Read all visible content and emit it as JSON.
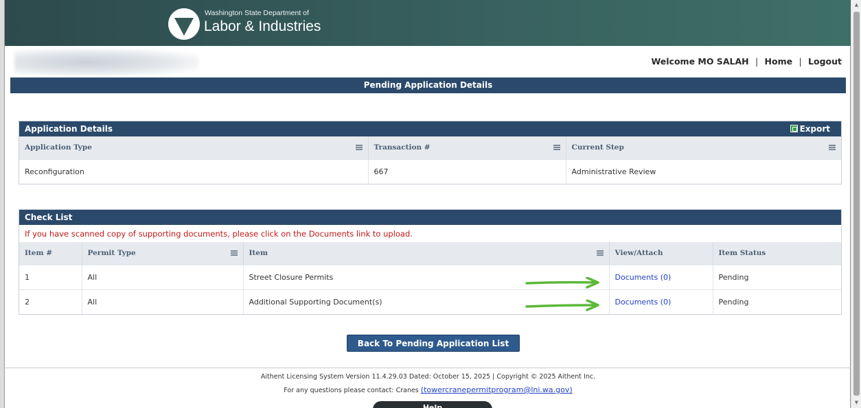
{
  "header": {
    "org_small": "Washington State Department of",
    "org_big": "Labor & Industries"
  },
  "nav": {
    "welcome": "Welcome MO SALAH",
    "home": "Home",
    "logout": "Logout",
    "separator": "|"
  },
  "page_title": "Pending Application Details",
  "application_details": {
    "title": "Application Details",
    "export_label": "Export",
    "columns": [
      "Application Type",
      "Transaction #",
      "Current Step"
    ],
    "row": [
      "Reconfiguration",
      "667",
      "Administrative Review"
    ]
  },
  "checklist": {
    "title": "Check List",
    "instruction": "If you have scanned copy of supporting documents, please click on the Documents link to upload.",
    "columns": [
      "Item #",
      "Permit Type",
      "Item",
      "View/Attach",
      "Item Status"
    ],
    "rows": [
      [
        "1",
        "All",
        "Street Closure Permits",
        "Documents (0)",
        "Pending"
      ],
      [
        "2",
        "All",
        "Additional Supporting Document(s)",
        "Documents (0)",
        "Pending"
      ]
    ]
  },
  "back_button": "Back To Pending Application List",
  "footer": {
    "line1": "Aithent Licensing System Version 11.4.29.03 Dated: October 15, 2025 | Copyright © 2025 Aithent Inc.",
    "line2_prefix": "For any questions please contact: Cranes",
    "email": "(towercranepermitprogram@lni.wa.gov)"
  },
  "help_tab": "Help",
  "colors": {
    "header_band": "#38605f",
    "section_bar": "#2b4a6b",
    "link": "#2441c8",
    "warning_text": "#c01818",
    "arrow": "#5cb83a"
  },
  "icons": [
    "lni-logo-icon",
    "export-icon",
    "column-menu-icon",
    "green-arrow-icon",
    "scroll-up-icon",
    "scroll-down-icon"
  ]
}
